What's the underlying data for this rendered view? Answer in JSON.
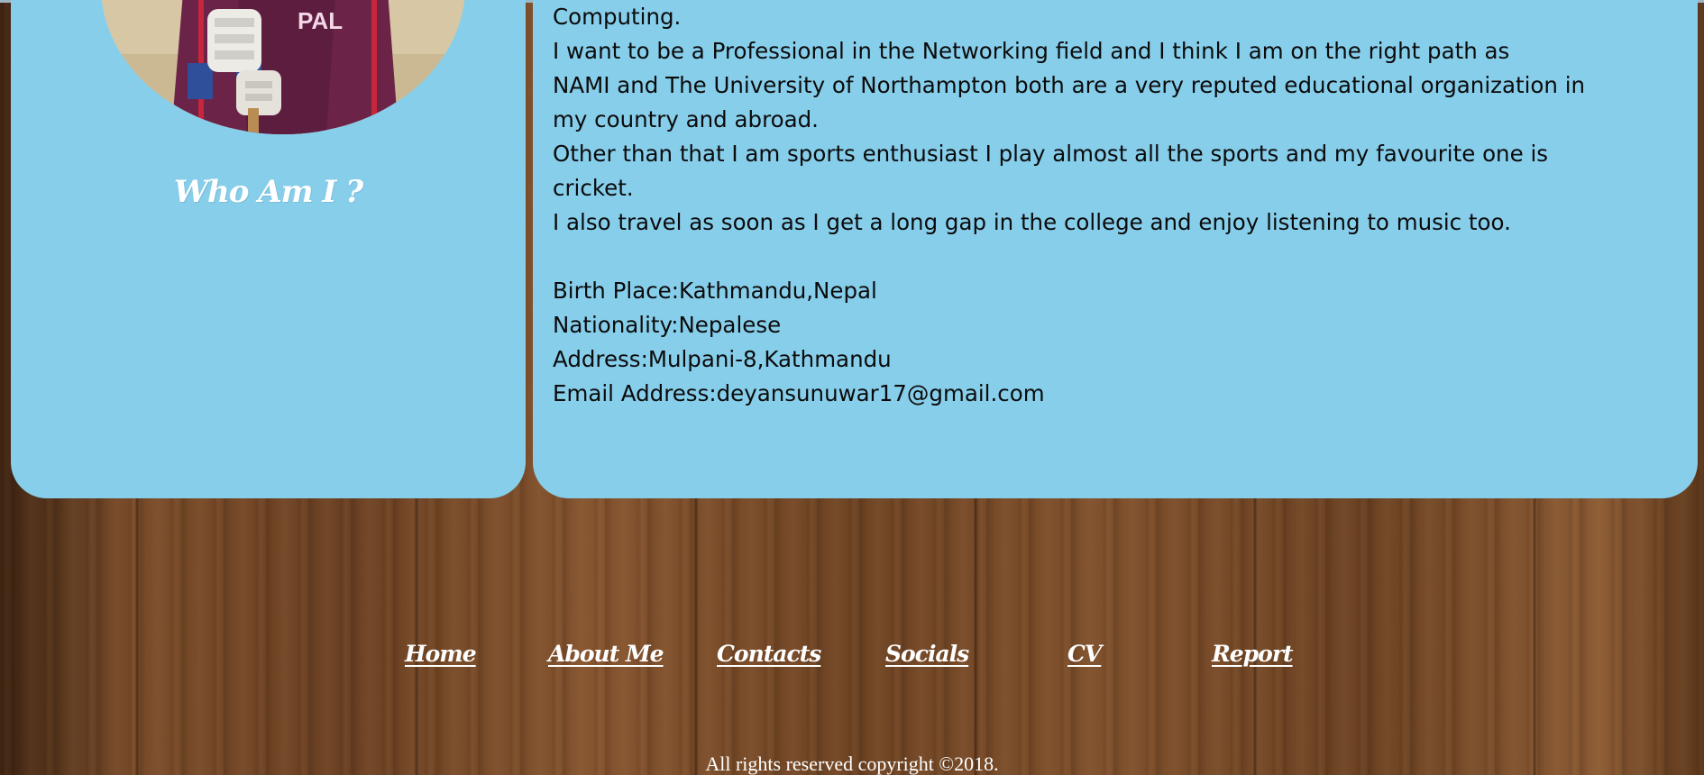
{
  "profile": {
    "photo_alt": "Profile photo",
    "who_title": "Who Am I ?",
    "jersey_text": "PAL"
  },
  "bio": {
    "lines": [
      "Computing.",
      "I want to be a Professional in the Networking field and I think I am on the right path as",
      "NAMI and The University of Northampton both are a very reputed educational organization in",
      "my country and abroad.",
      "Other than that I am sports enthusiast I play almost all the sports and my favourite one is",
      "cricket.",
      "I also travel as soon as I get a long gap in the college and enjoy listening to music too."
    ],
    "birth_place": "Birth Place:Kathmandu,Nepal",
    "nationality": "Nationality:Nepalese",
    "address": "Address:Mulpani-8,Kathmandu",
    "email": "Email Address:deyansunuwar17@gmail.com"
  },
  "nav": {
    "home": "Home",
    "about": "About Me",
    "contacts": "Contacts",
    "socials": "Socials",
    "cv": "CV",
    "report": "Report"
  },
  "footer": {
    "copyright": "All rights reserved copyright ©2018."
  },
  "colors": {
    "panel": "#87ceeb",
    "wood": "#6e4426",
    "text_dark": "#0b0b0b",
    "text_light": "#ffffff"
  }
}
